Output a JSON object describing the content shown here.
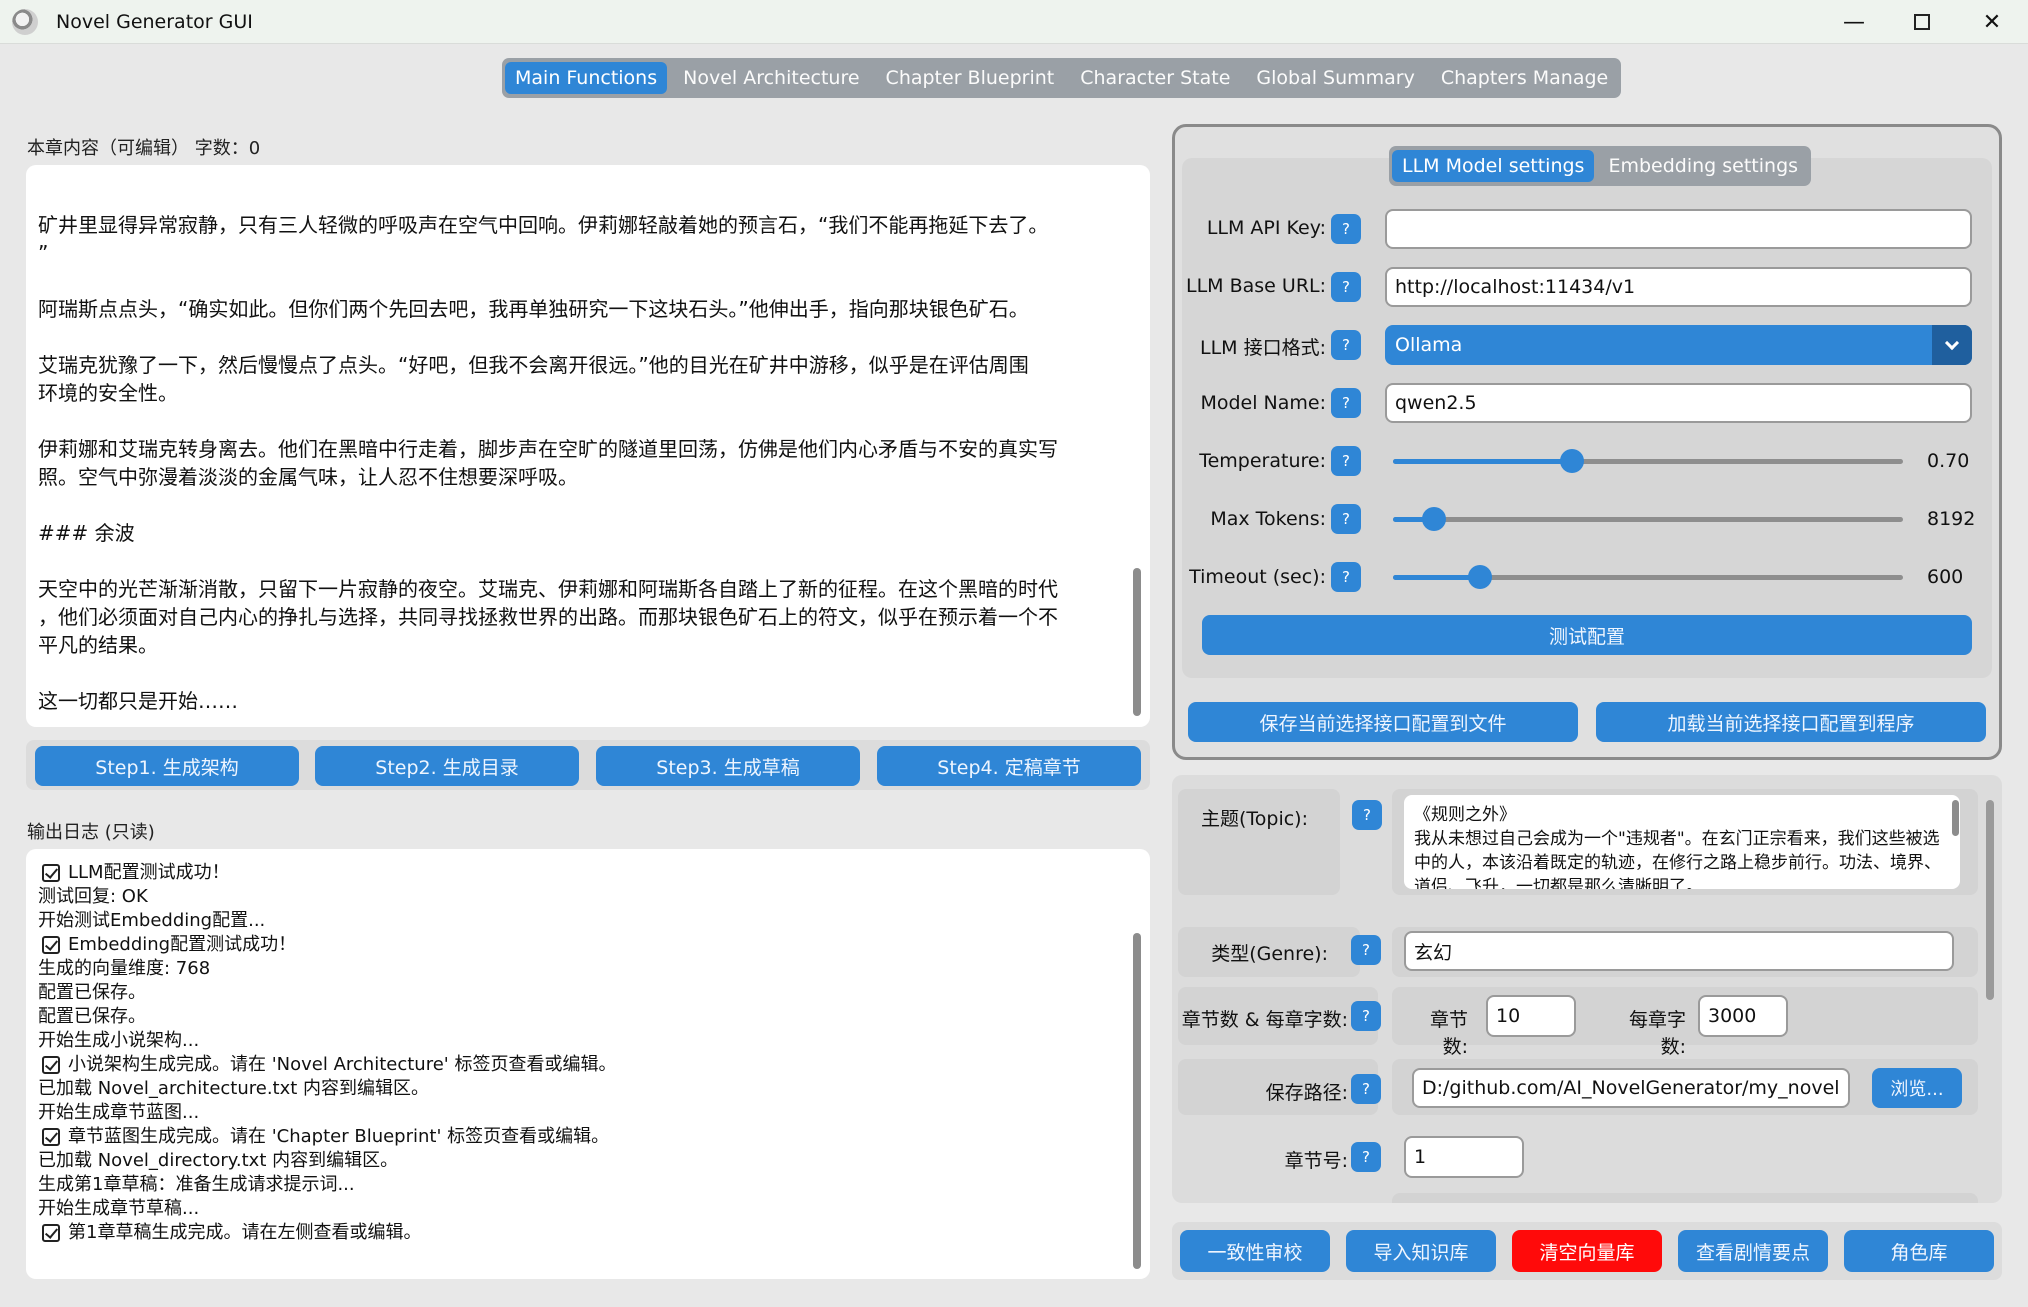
{
  "window": {
    "title": "Novel Generator GUI"
  },
  "tabs": [
    "Main Functions",
    "Novel Architecture",
    "Chapter Blueprint",
    "Character State",
    "Global Summary",
    "Chapters Manage"
  ],
  "editor": {
    "label": "本章内容（可编辑）  字数：0",
    "lines": [
      "矿井里显得异常寂静，只有三人轻微的呼吸声在空气中回响。伊莉娜轻敲着她的预言石，“我们不能再拖延下去了。",
      "”",
      "",
      "阿瑞斯点点头，“确实如此。但你们两个先回去吧，我再单独研究一下这块石头。”他伸出手，指向那块银色矿石。",
      "",
      "艾瑞克犹豫了一下，然后慢慢点了点头。“好吧，但我不会离开很远。”他的目光在矿井中游移，似乎是在评估周围",
      "环境的安全性。",
      "",
      "伊莉娜和艾瑞克转身离去。他们在黑暗中行走着，脚步声在空旷的隧道里回荡，仿佛是他们内心矛盾与不安的真实写",
      "照。空气中弥漫着淡淡的金属气味，让人忍不住想要深呼吸。",
      "",
      "### 余波",
      "",
      "天空中的光芒渐渐消散，只留下一片寂静的夜空。艾瑞克、伊莉娜和阿瑞斯各自踏上了新的征程。在这个黑暗的时代",
      "，他们必须面对自己内心的挣扎与选择，共同寻找拯救世界的出路。而那块银色矿石上的符文，似乎在预示着一个不",
      "平凡的结果。",
      "",
      "这一切都只是开始……"
    ]
  },
  "steps": [
    "Step1. 生成架构",
    "Step2. 生成目录",
    "Step3. 生成草稿",
    "Step4. 定稿章节"
  ],
  "log": {
    "label": "输出日志 (只读)",
    "lines": [
      {
        "check": true,
        "text": "LLM配置测试成功！"
      },
      {
        "check": false,
        "text": "测试回复: OK"
      },
      {
        "check": false,
        "text": "开始测试Embedding配置..."
      },
      {
        "check": true,
        "text": "Embedding配置测试成功！"
      },
      {
        "check": false,
        "text": "生成的向量维度: 768"
      },
      {
        "check": false,
        "text": "配置已保存。"
      },
      {
        "check": false,
        "text": "配置已保存。"
      },
      {
        "check": false,
        "text": "开始生成小说架构..."
      },
      {
        "check": true,
        "text": "小说架构生成完成。请在 'Novel Architecture' 标签页查看或编辑。"
      },
      {
        "check": false,
        "text": "已加载 Novel_architecture.txt 内容到编辑区。"
      },
      {
        "check": false,
        "text": "开始生成章节蓝图..."
      },
      {
        "check": true,
        "text": "章节蓝图生成完成。请在 'Chapter Blueprint' 标签页查看或编辑。"
      },
      {
        "check": false,
        "text": "已加载 Novel_directory.txt 内容到编辑区。"
      },
      {
        "check": false,
        "text": "生成第1章草稿：准备生成请求提示词..."
      },
      {
        "check": false,
        "text": "开始生成章节草稿..."
      },
      {
        "check": true,
        "text": "第1章草稿生成完成。请在左侧查看或编辑。"
      }
    ]
  },
  "llm": {
    "subtabs": [
      "LLM Model settings",
      "Embedding settings"
    ],
    "api_key_label": "LLM API Key:",
    "api_key_value": "",
    "base_url_label": "LLM Base URL:",
    "base_url_value": "http://localhost:11434/v1",
    "interface_label": "LLM 接口格式:",
    "interface_value": "Ollama",
    "model_label": "Model Name:",
    "model_value": "qwen2.5",
    "temperature_label": "Temperature:",
    "temperature_value": "0.70",
    "temperature_fraction": 0.35,
    "max_tokens_label": "Max Tokens:",
    "max_tokens_value": "8192",
    "max_tokens_fraction": 0.08,
    "timeout_label": "Timeout (sec):",
    "timeout_value": "600",
    "timeout_fraction": 0.17,
    "help_glyph": "?",
    "test_button": "测试配置",
    "save_button": "保存当前选择接口配置到文件",
    "load_button": "加载当前选择接口配置到程序"
  },
  "novel": {
    "topic_label": "主题(Topic):",
    "topic_value": "《规则之外》\n我从未想过自己会成为一个\"违规者\"。在玄门正宗看来，我们这些被选中的人，本该沿着既定的轨迹，在修行之路上稳步前行。功法、境界、道侣、飞升，一切都是那么清晰明了。",
    "genre_label": "类型(Genre):",
    "genre_value": "玄幻",
    "chapters_label": "章节数 & 每章字数:",
    "num_chapters_label": "章节数:",
    "num_chapters_value": "10",
    "words_label": "每章字数:",
    "words_value": "3000",
    "path_label": "保存路径:",
    "path_value": "D:/github.com/AI_NovelGenerator/my_novel",
    "browse_button": "浏览...",
    "chapter_no_label": "章节号:",
    "chapter_no_value": "1"
  },
  "bottom_buttons": [
    "一致性审校",
    "导入知识库",
    "清空向量库",
    "查看剧情要点",
    "角色库"
  ],
  "colors": {
    "accent": "#2f86d6",
    "danger": "#ff0a0a",
    "background": "#e8e8e8"
  }
}
